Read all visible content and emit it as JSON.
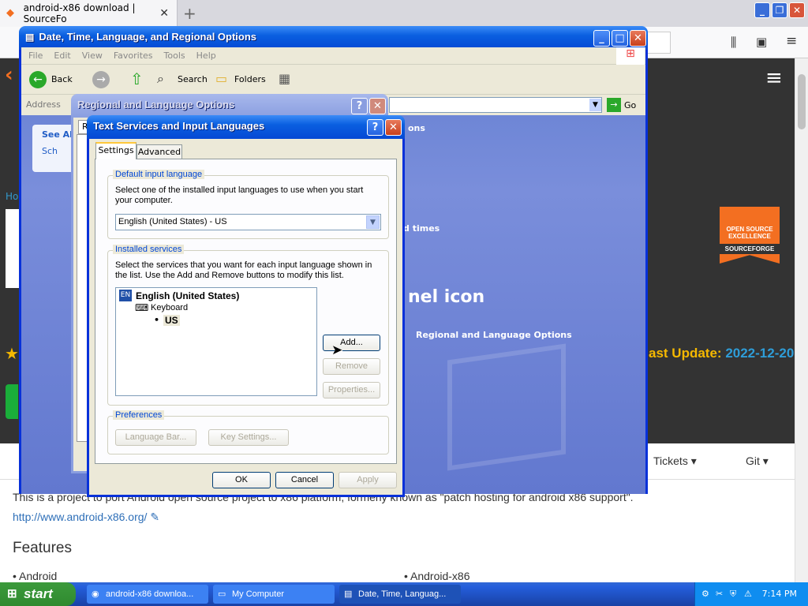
{
  "browser": {
    "tab_title": "android-x86 download | SourceFo",
    "new_tab": "+"
  },
  "sourceforge": {
    "breadcrumb": "Ho",
    "last_update_label": "ast Update:",
    "last_update_value": "2022-12-20",
    "badge_l1": "OPEN SOURCE",
    "badge_l2": "EXCELLENCE",
    "badge_l3": "SOURCEFORGE",
    "menu_tickets": "Tickets ▾",
    "menu_git": "Git ▾",
    "description": "This is a project to port Android open source project to x86 platform, formerly known as \"patch hosting for android x86 support\".",
    "link": "http://www.android-x86.org/",
    "features_heading": "Features",
    "feature1": "• Android",
    "feature2": "• Android-x86"
  },
  "explorer": {
    "title": "Date, Time, Language, and Regional Options",
    "menu": [
      "File",
      "Edit",
      "View",
      "Favorites",
      "Tools",
      "Help"
    ],
    "back": "Back",
    "search": "Search",
    "folders": "Folders",
    "address_label": "Address",
    "go": "Go",
    "see_also": "See Al",
    "sch": "Sch",
    "bg_ions": "ons",
    "bg_times": "d times",
    "bg_icon": "nel icon",
    "bg_regional": "Regional and Language Options"
  },
  "regional": {
    "title": "Regional and Language Options",
    "tab_initial": "R"
  },
  "dialog": {
    "title": "Text Services and Input Languages",
    "tabs": [
      "Settings",
      "Advanced"
    ],
    "default_group": "Default input language",
    "default_desc": "Select one of the installed input languages to use when you start your computer.",
    "default_value": "English (United States) - US",
    "installed_group": "Installed services",
    "installed_desc": "Select the services that you want for each input language shown in the list. Use the Add and Remove buttons to modify this list.",
    "lang_code": "EN",
    "lang_name": "English (United States)",
    "keyboard": "Keyboard",
    "layout": "US",
    "add": "Add...",
    "remove": "Remove",
    "properties": "Properties...",
    "prefs_group": "Preferences",
    "language_bar": "Language Bar...",
    "key_settings": "Key Settings...",
    "ok": "OK",
    "cancel": "Cancel",
    "apply": "Apply"
  },
  "taskbar": {
    "start": "start",
    "items": [
      "android-x86 downloa...",
      "My Computer",
      "Date, Time, Languag..."
    ],
    "clock": "7:14 PM"
  }
}
